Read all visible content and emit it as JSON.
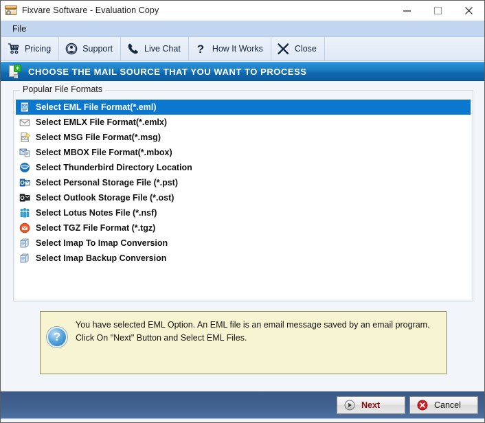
{
  "window": {
    "title": "Fixvare Software - Evaluation Copy",
    "icon": "archive-box-icon",
    "controls": [
      {
        "name": "minimize",
        "glyph": "minimize-icon"
      },
      {
        "name": "maximize",
        "glyph": "maximize-icon"
      },
      {
        "name": "close",
        "glyph": "close-icon"
      }
    ]
  },
  "menubar": {
    "items": [
      {
        "label": "File"
      }
    ]
  },
  "toolbar": {
    "items": [
      {
        "label": "Pricing",
        "icon": "shopping-cart-icon"
      },
      {
        "label": "Support",
        "icon": "user-circle-icon"
      },
      {
        "label": "Live Chat",
        "icon": "phone-icon"
      },
      {
        "label": "How It Works",
        "icon": "question-mark-icon"
      },
      {
        "label": "Close",
        "icon": "x-cross-icon"
      }
    ]
  },
  "band": {
    "icon": "new-document-icon",
    "title": "CHOOSE THE MAIL SOURCE THAT YOU WANT TO PROCESS"
  },
  "group": {
    "title": "Popular File Formats",
    "items": [
      {
        "label": "Select EML File Format(*.eml)",
        "icon": "eml-file-icon",
        "selected": true
      },
      {
        "label": "Select EMLX File Format(*.emlx)",
        "icon": "envelope-icon",
        "selected": false
      },
      {
        "label": "Select MSG File Format(*.msg)",
        "icon": "msg-file-icon",
        "selected": false
      },
      {
        "label": "Select MBOX File Format(*.mbox)",
        "icon": "mbox-file-icon",
        "selected": false
      },
      {
        "label": "Select Thunderbird Directory Location",
        "icon": "thunderbird-icon",
        "selected": false
      },
      {
        "label": "Select Personal Storage File (*.pst)",
        "icon": "outlook-pst-icon",
        "selected": false
      },
      {
        "label": "Select Outlook Storage File (*.ost)",
        "icon": "outlook-ost-icon",
        "selected": false
      },
      {
        "label": "Select Lotus Notes File (*.nsf)",
        "icon": "lotus-notes-icon",
        "selected": false
      },
      {
        "label": "Select TGZ File Format (*.tgz)",
        "icon": "tgz-file-icon",
        "selected": false
      },
      {
        "label": "Select Imap To Imap Conversion",
        "icon": "imap-server-icon",
        "selected": false
      },
      {
        "label": "Select Imap Backup Conversion",
        "icon": "imap-server-icon",
        "selected": false
      }
    ]
  },
  "info": {
    "icon": "help-question-icon",
    "text": "You have selected EML Option. An EML file is an email message saved by an email program. Click On \"Next\" Button and Select EML Files."
  },
  "footer": {
    "next_label": "Next",
    "next_icon": "play-circle-icon",
    "cancel_label": "Cancel",
    "cancel_icon": "error-circle-icon"
  },
  "colors": {
    "band_blue": "#1b7ec4",
    "selection_blue": "#0b78d0",
    "footer_blue": "#40608e",
    "info_yellow": "#f7f5d1",
    "next_red": "#8c1212"
  }
}
